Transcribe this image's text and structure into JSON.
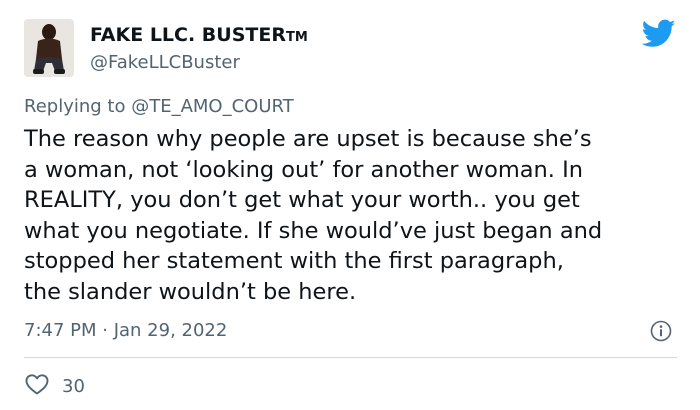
{
  "tweet": {
    "display_name": "FAKE LLC. BUSTER",
    "trademark": "TM",
    "handle": "@FakeLLCBuster",
    "replying_to_prefix": "Replying to ",
    "replying_to_handle": "@TE_AMO_COURT",
    "text_lines": [
      "The reason why people are upset is because she’s",
      "a woman, not ‘looking out’ for another woman. In",
      "REALITY, you don’t get what your worth.. you get",
      "what you negotiate. If she would’ve just began and",
      "stopped her statement with the first paragraph,",
      "the slander wouldn’t be here."
    ],
    "timestamp": "7:47 PM · Jan 29, 2022",
    "like_count": "30"
  },
  "icons": {
    "platform": "twitter-bird-icon",
    "info": "info-icon",
    "like": "heart-icon"
  },
  "colors": {
    "brand_blue": "#1d9bf0",
    "text_primary": "#0f1419",
    "text_secondary": "#536471",
    "divider": "#cfd9de"
  }
}
